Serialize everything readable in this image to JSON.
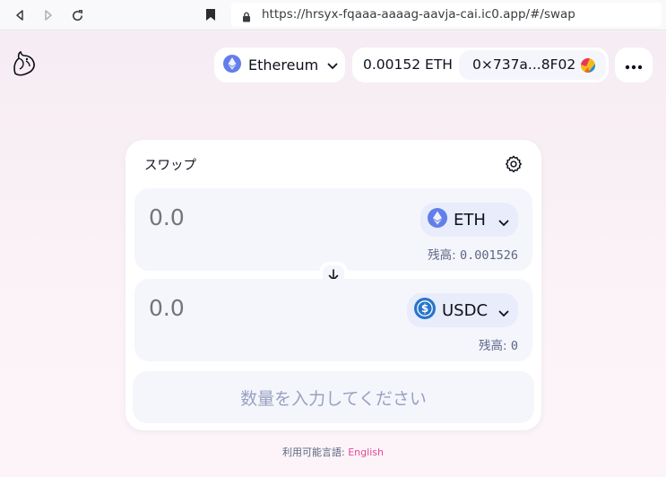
{
  "browser": {
    "url": "https://hrsyx-fqaaa-aaaag-aavja-cai.ic0.app/#/swap"
  },
  "header": {
    "network_label": "Ethereum",
    "balance_label": "0.00152 ETH",
    "address_label": "0×737a...8F02"
  },
  "swap": {
    "title": "スワップ",
    "input": {
      "placeholder": "0.0",
      "token": "ETH",
      "balance_label": "残高:",
      "balance_value": "0.001526"
    },
    "output": {
      "placeholder": "0.0",
      "token": "USDC",
      "balance_label": "残高:",
      "balance_value": "0"
    },
    "submit_label": "数量を入力してください"
  },
  "footer": {
    "available_label": "利用可能言語:",
    "language_link": "English"
  },
  "colors": {
    "accent_pink": "#e8479d",
    "eth_blue": "#627eea",
    "usdc_blue": "#2775ca",
    "text_dark": "#0d111c",
    "placeholder_gray": "#c3c5cb"
  },
  "icons": [
    "back-icon",
    "forward-icon",
    "reload-icon",
    "bookmark-icon",
    "lock-icon",
    "uniswap-logo",
    "eth-icon",
    "chevron-down-icon",
    "more-icon",
    "gear-icon",
    "arrow-down-icon",
    "usdc-icon",
    "avatar"
  ]
}
